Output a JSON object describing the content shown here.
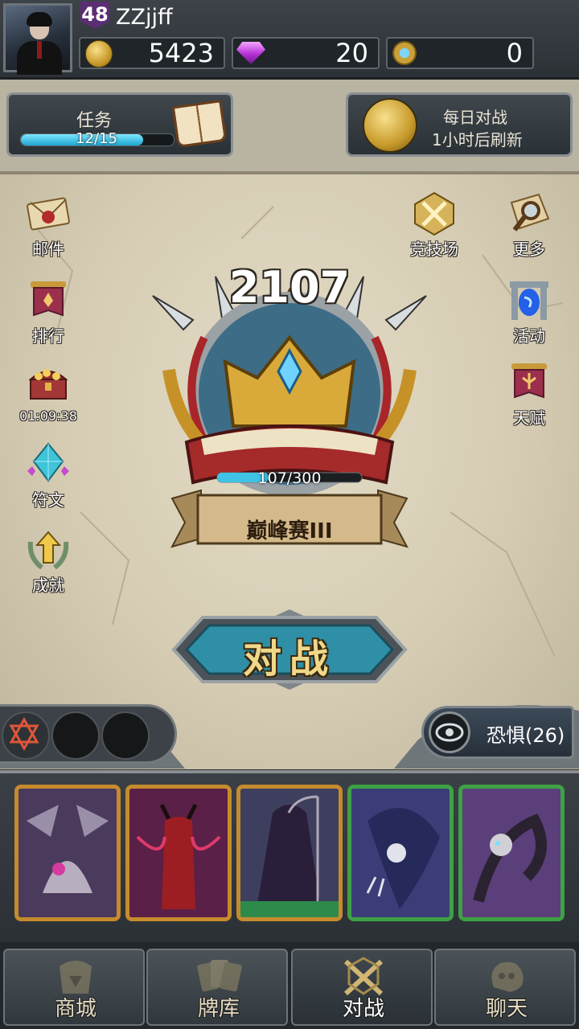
{
  "player": {
    "level": "48",
    "name": "ZZjjff"
  },
  "resources": {
    "gold": "5423",
    "gems": "20",
    "tokens": "0"
  },
  "quest": {
    "title": "任务",
    "progress_text": "12/15",
    "progress": 0.8
  },
  "daily_battle": {
    "title": "每日对战",
    "subtitle": "1小时后刷新"
  },
  "side_menu_left": [
    {
      "label": "邮件",
      "icon": "mail-icon"
    },
    {
      "label": "排行",
      "icon": "ranking-banner-icon"
    },
    {
      "label": "01:09:38",
      "icon": "treasure-chest-icon"
    },
    {
      "label": "符文",
      "icon": "rune-crystal-icon"
    },
    {
      "label": "成就",
      "icon": "achievement-laurel-icon"
    }
  ],
  "side_menu_right": [
    {
      "label": "竞技场",
      "icon": "arena-swords-icon"
    },
    {
      "label": "更多",
      "icon": "magnifier-map-icon"
    },
    {
      "label": "活动",
      "icon": "portal-icon"
    },
    {
      "label": "天赋",
      "icon": "talent-banner-icon"
    }
  ],
  "rank": {
    "score": "2107",
    "progress_text": "107/300",
    "progress": 0.357,
    "tier": "巅峰赛III"
  },
  "battle_button": {
    "label": "对战"
  },
  "fear": {
    "label": "恐惧(26)"
  },
  "cards": [
    {
      "rarity": "gold",
      "name": "bone-dragon"
    },
    {
      "rarity": "gold",
      "name": "red-demon"
    },
    {
      "rarity": "gold",
      "name": "grim-reaper"
    },
    {
      "rarity": "green",
      "name": "wraith"
    },
    {
      "rarity": "green",
      "name": "bone-centipede"
    }
  ],
  "nav": [
    {
      "label": "商城",
      "icon": "shop-icon"
    },
    {
      "label": "牌库",
      "icon": "card-library-icon"
    },
    {
      "label": "对战",
      "icon": "battle-icon",
      "active": true
    },
    {
      "label": "聊天",
      "icon": "chat-icon"
    }
  ],
  "colors": {
    "gold_border": "#c58b2d",
    "green_border": "#3ea144",
    "accent_cyan": "#3fc4e6",
    "battle_text": "#f0d88a"
  }
}
